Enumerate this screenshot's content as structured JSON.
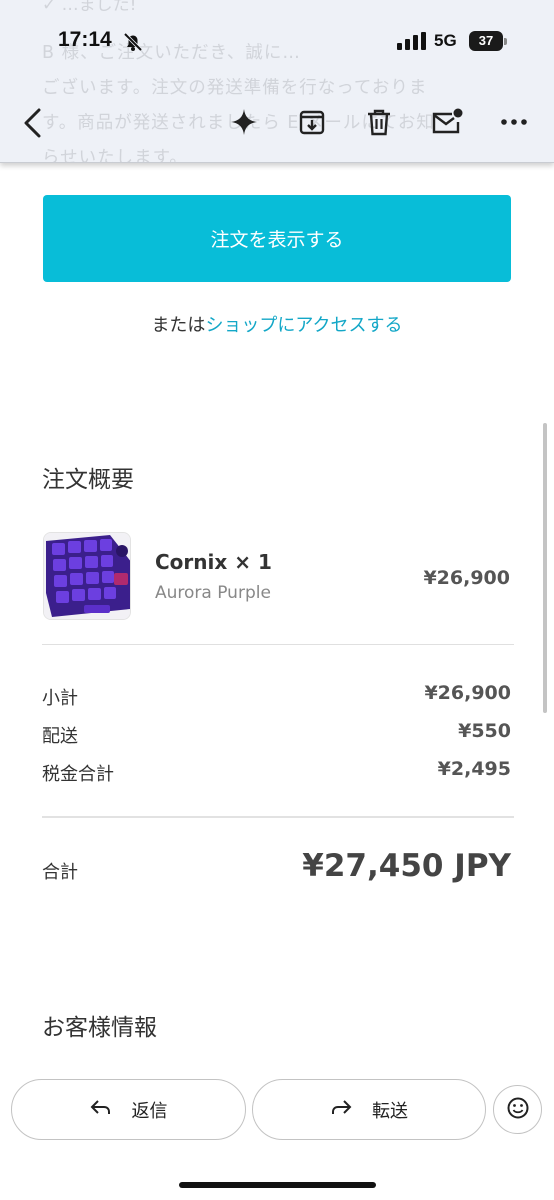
{
  "status_bar": {
    "time": "17:14",
    "network": "5G",
    "battery": "37"
  },
  "background_text": {
    "partial_heading": "✓ …ました!",
    "lines": [
      "B 様、ご注文いただき、誠に…",
      "ございます。注文の発送準備を行なっておりま",
      "す。商品が発送されましたら E メールにてお知",
      "らせいたします。"
    ]
  },
  "toolbar": {
    "icons": [
      "back-icon",
      "sparkle-icon",
      "archive-icon",
      "trash-icon",
      "mark-unread-icon",
      "more-icon"
    ]
  },
  "email": {
    "cta_label": "注文を表示する",
    "or_prefix": "または",
    "shop_link": "ショップにアクセスする",
    "summary_title": "注文概要",
    "product": {
      "name": "Cornix × 1",
      "variant": "Aurora Purple",
      "price": "¥26,900"
    },
    "rows": [
      {
        "label": "小計",
        "value": "¥26,900"
      },
      {
        "label": "配送",
        "value": "¥550"
      },
      {
        "label": "税金合計",
        "value": "¥2,495"
      }
    ],
    "total": {
      "label": "合計",
      "value": "¥27,450 JPY"
    },
    "customer_title": "お客様情報"
  },
  "actions": {
    "reply": "返信",
    "forward": "転送"
  },
  "colors": {
    "accent": "#08bdd8",
    "link": "#13a7c7",
    "header_bg": "#eef1f7"
  }
}
